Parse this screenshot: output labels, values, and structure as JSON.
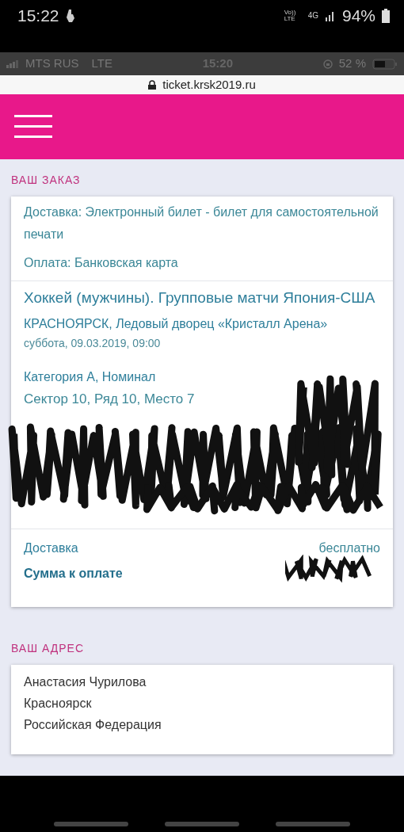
{
  "phone_status": {
    "time": "15:22",
    "volte": "Vo)) LTE",
    "network": "4G",
    "battery": "94%"
  },
  "screenshot_status": {
    "carrier": "MTS RUS",
    "network": "LTE",
    "time": "15:20",
    "battery": "52 %"
  },
  "address_bar": {
    "url": "ticket.krsk2019.ru"
  },
  "order": {
    "heading": "ВАШ ЗАКАЗ",
    "delivery": {
      "label": "Доставка:",
      "value": "Электронный билет - билет для самостоятельной печати"
    },
    "payment": {
      "label": "Оплата:",
      "value": "Банковская карта"
    },
    "event": {
      "title": "Хоккей (мужчины). Групповые матчи Япония-США",
      "venue": "КРАСНОЯРСК, Ледовый дворец «Кристалл Арена»",
      "datetime": "суббота, 09.03.2019, 09:00"
    },
    "ticket": {
      "category": "Категория А, Номинал",
      "seat": "Сектор 10, Ряд 10, Место 7"
    },
    "summary": [
      {
        "kind": "line",
        "label": "Доставка",
        "value": "бесплатно"
      },
      {
        "kind": "total",
        "label": "Сумма к оплате"
      }
    ]
  },
  "address": {
    "heading": "ВАШ АДРЕС",
    "lines": [
      "Анастасия Чурилова",
      "Красноярск",
      "Российская Федерация"
    ]
  }
}
